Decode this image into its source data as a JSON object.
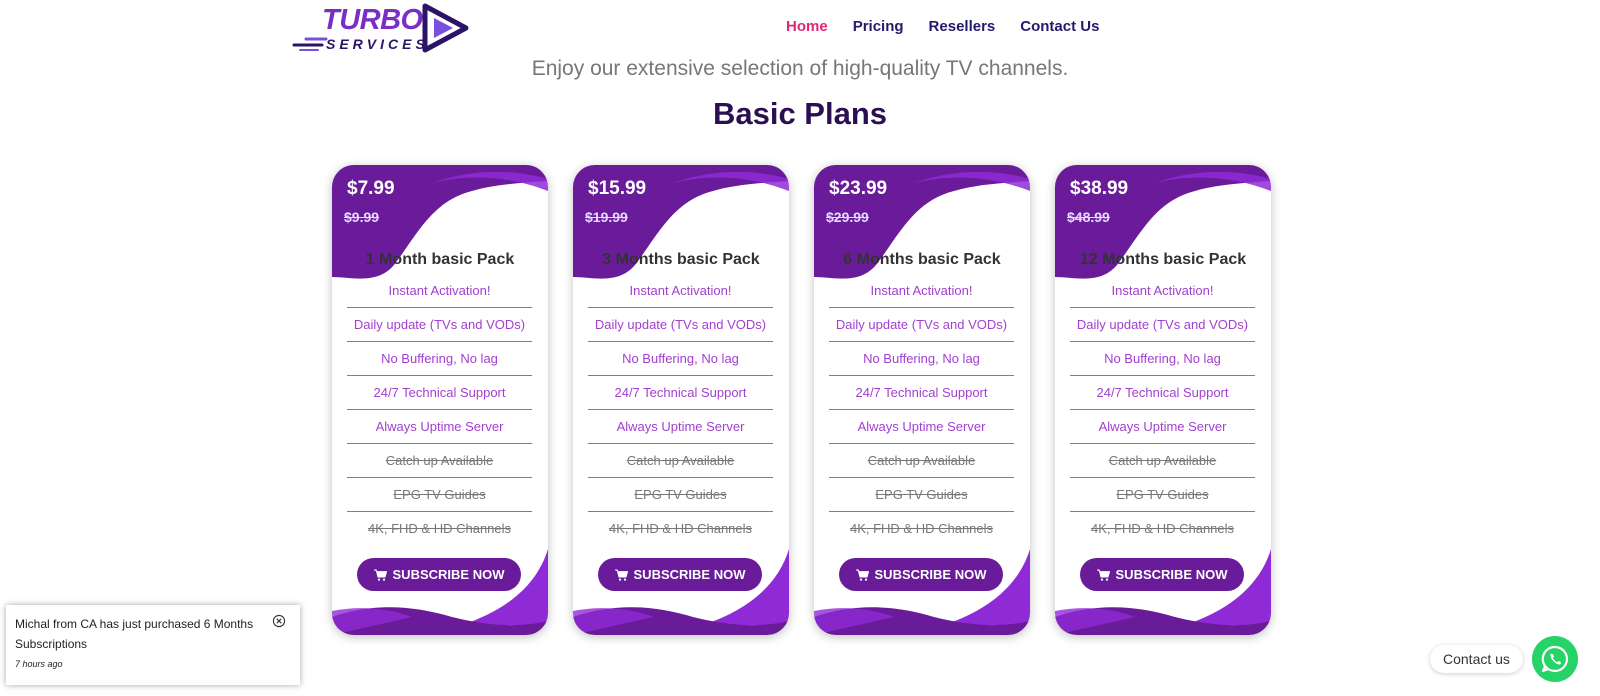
{
  "brand": {
    "name_top": "TURBO",
    "name_bottom": "SERVICES"
  },
  "nav": [
    {
      "label": "Home",
      "active": true
    },
    {
      "label": "Pricing",
      "active": false
    },
    {
      "label": "Resellers",
      "active": false
    },
    {
      "label": "Contact Us",
      "active": false
    }
  ],
  "tagline": "Enjoy our extensive selection of high-quality TV channels.",
  "section_title": "Basic Plans",
  "plans": [
    {
      "price": "$7.99",
      "old_price": "$9.99",
      "title": "1 Month basic Pack",
      "features": [
        {
          "text": "Instant Activation!",
          "included": true
        },
        {
          "text": "Daily update (TVs and VODs)",
          "included": true
        },
        {
          "text": "No Buffering, No lag",
          "included": true
        },
        {
          "text": "24/7 Technical Support",
          "included": true
        },
        {
          "text": "Always Uptime Server",
          "included": true
        },
        {
          "text": "Catch up Available",
          "included": false
        },
        {
          "text": "EPG TV Guides",
          "included": false
        },
        {
          "text": "4K, FHD & HD Channels",
          "included": false
        }
      ],
      "button": "SUBSCRIBE NOW"
    },
    {
      "price": "$15.99",
      "old_price": "$19.99",
      "title": "3 Months basic Pack",
      "features": [
        {
          "text": "Instant Activation!",
          "included": true
        },
        {
          "text": "Daily update (TVs and VODs)",
          "included": true
        },
        {
          "text": "No Buffering, No lag",
          "included": true
        },
        {
          "text": "24/7 Technical Support",
          "included": true
        },
        {
          "text": "Always Uptime Server",
          "included": true
        },
        {
          "text": "Catch up Available",
          "included": false
        },
        {
          "text": "EPG TV Guides",
          "included": false
        },
        {
          "text": "4K, FHD & HD Channels",
          "included": false
        }
      ],
      "button": "SUBSCRIBE NOW"
    },
    {
      "price": "$23.99",
      "old_price": "$29.99",
      "title": "6 Months basic Pack",
      "features": [
        {
          "text": "Instant Activation!",
          "included": true
        },
        {
          "text": "Daily update (TVs and VODs)",
          "included": true
        },
        {
          "text": "No Buffering, No lag",
          "included": true
        },
        {
          "text": "24/7 Technical Support",
          "included": true
        },
        {
          "text": "Always Uptime Server",
          "included": true
        },
        {
          "text": "Catch up Available",
          "included": false
        },
        {
          "text": "EPG TV Guides",
          "included": false
        },
        {
          "text": "4K, FHD & HD Channels",
          "included": false
        }
      ],
      "button": "SUBSCRIBE NOW"
    },
    {
      "price": "$38.99",
      "old_price": "$48.99",
      "title": "12 Months basic Pack",
      "features": [
        {
          "text": "Instant Activation!",
          "included": true
        },
        {
          "text": "Daily update (TVs and VODs)",
          "included": true
        },
        {
          "text": "No Buffering, No lag",
          "included": true
        },
        {
          "text": "24/7 Technical Support",
          "included": true
        },
        {
          "text": "Always Uptime Server",
          "included": true
        },
        {
          "text": "Catch up Available",
          "included": false
        },
        {
          "text": "EPG TV Guides",
          "included": false
        },
        {
          "text": "4K, FHD & HD Channels",
          "included": false
        }
      ],
      "button": "SUBSCRIBE NOW"
    }
  ],
  "notification": {
    "message": "Michal from CA has just purchased 6 Months Subscriptions",
    "time": "7 hours ago",
    "close_icon": "close-circle-icon"
  },
  "contact": {
    "label": "Contact us",
    "icon": "whatsapp-icon"
  },
  "colors": {
    "brand_purple": "#6a1b9a",
    "nav_active": "#e0267a",
    "feature_text": "#a23fcf",
    "whatsapp": "#25d366"
  }
}
